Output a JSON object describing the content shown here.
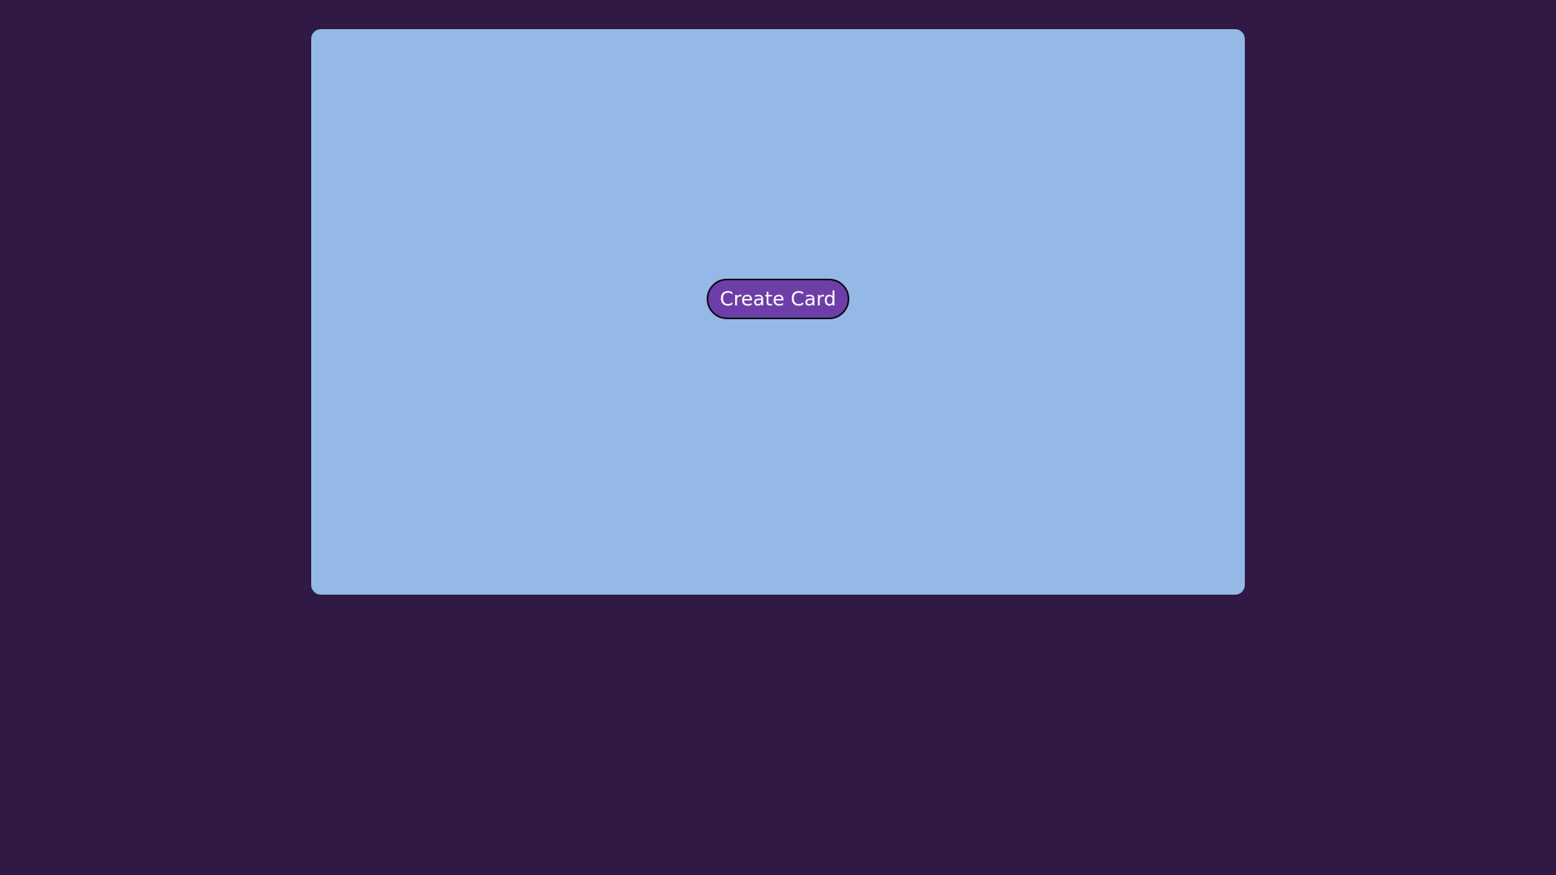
{
  "main": {
    "create_card_label": "Create Card"
  },
  "colors": {
    "background": "#301a45",
    "panel": "#95b9e7",
    "button": "#6e3ea8",
    "button_text": "#ffffff",
    "button_border": "#0e0716"
  }
}
